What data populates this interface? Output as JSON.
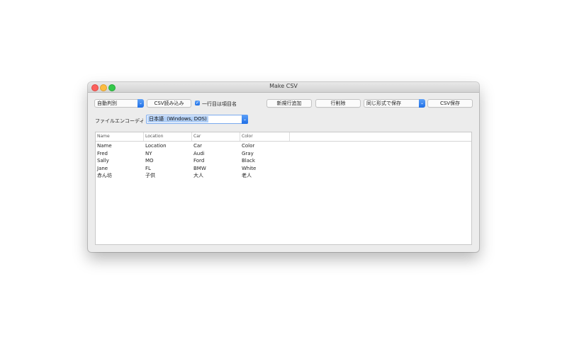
{
  "window": {
    "title": "Make CSV"
  },
  "toolbar": {
    "detect_popup": "自動判別",
    "read_button": "CSV読み込み",
    "header_checkbox_label": "一行目は項目名",
    "header_checkbox_checked": true,
    "add_row_button": "新規行追加",
    "delete_row_button": "行削除",
    "save_format_popup": "同じ形式で保存",
    "save_button": "CSV保存"
  },
  "encoding": {
    "label": "ファイルエンコーディ",
    "value": "日本語（Windows, DOS)"
  },
  "table": {
    "columns": [
      "Name",
      "Location",
      "Car",
      "Color"
    ],
    "rows": [
      [
        "Name",
        "Location",
        "Car",
        "Color"
      ],
      [
        "Fred",
        "NY",
        "Audi",
        "Gray"
      ],
      [
        "Sally",
        "MO",
        "Ford",
        "Black"
      ],
      [
        "Jane",
        "FL",
        "BMW",
        "White"
      ],
      [
        "赤ん坊",
        "子供",
        "大人",
        "老人"
      ]
    ]
  },
  "colors": {
    "accent": "#1f6fe6",
    "window_bg": "#ececec",
    "selection": "#b3d0f6"
  }
}
